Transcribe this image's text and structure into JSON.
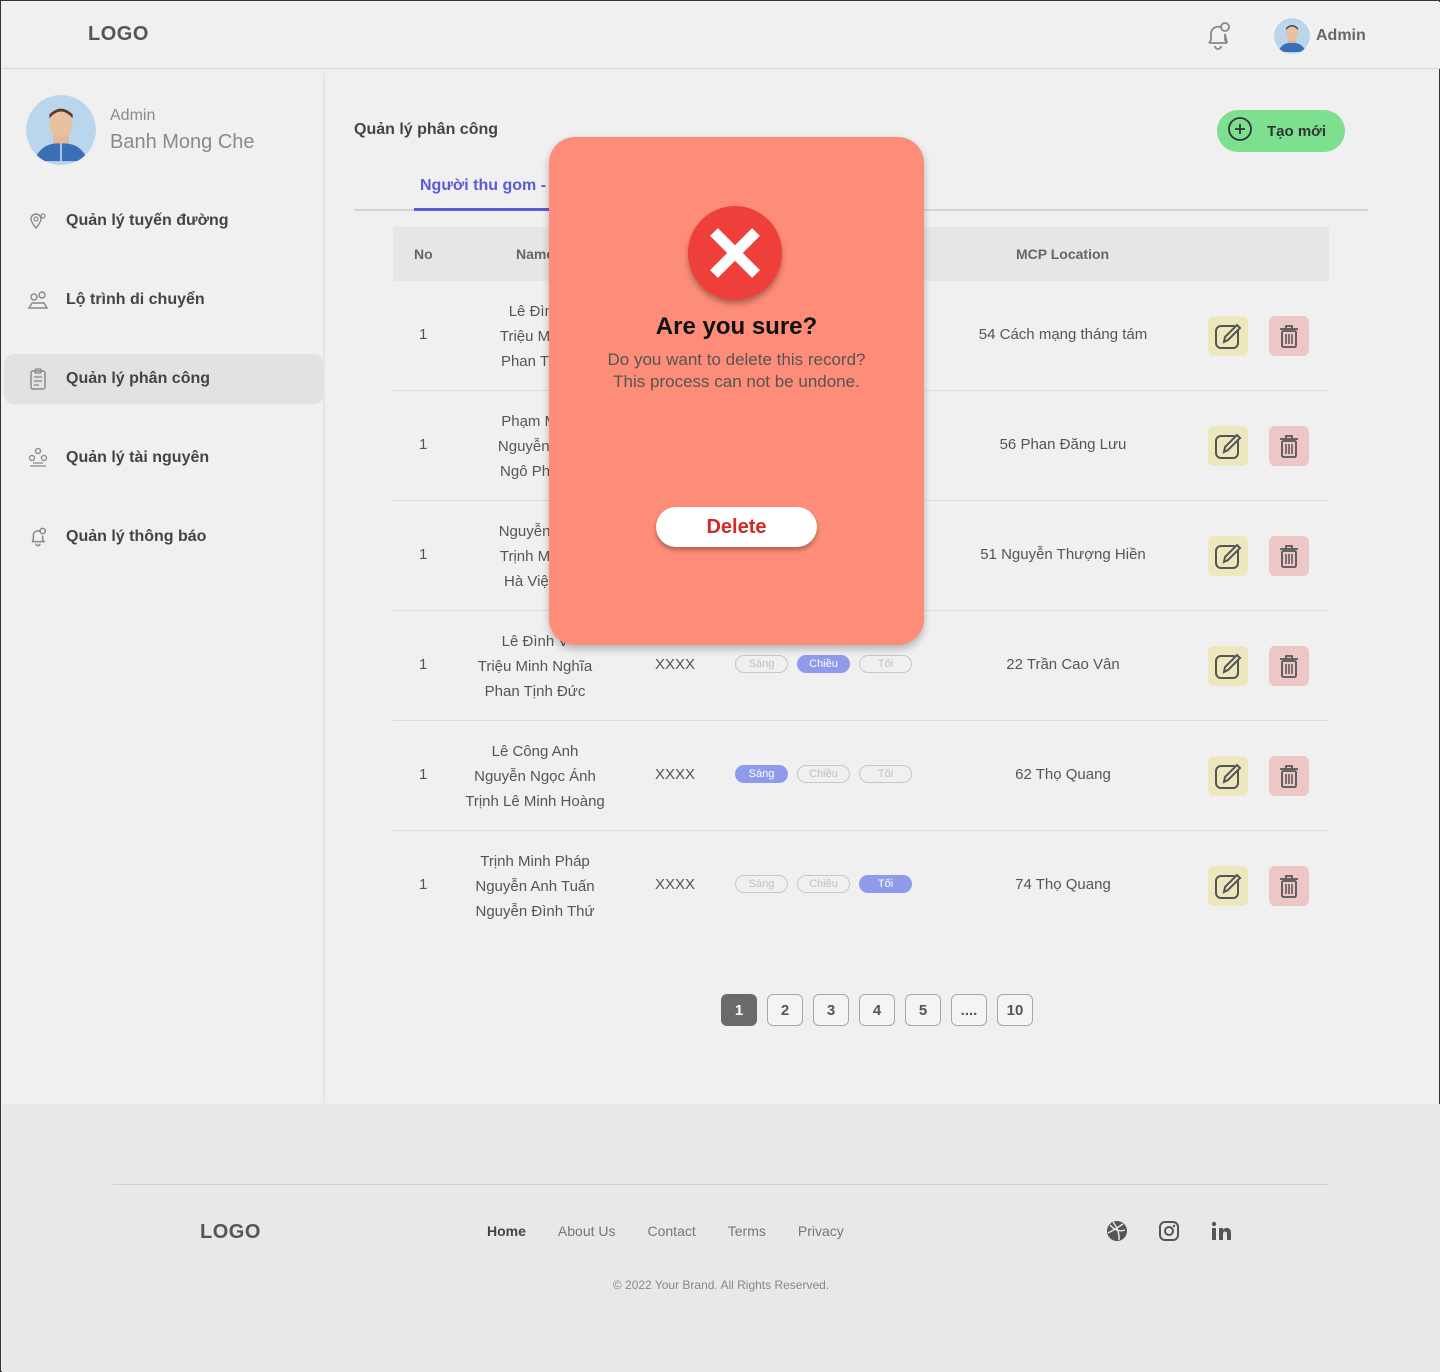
{
  "header": {
    "logo": "LOGO",
    "user_name": "Admin"
  },
  "sidebar": {
    "role": "Admin",
    "name": "Banh Mong Che",
    "items": [
      {
        "label": "Quản lý tuyến đường",
        "icon": "map-pin-icon"
      },
      {
        "label": "Lộ trình di chuyển",
        "icon": "route-icon"
      },
      {
        "label": "Quản lý phân công",
        "icon": "clipboard-icon",
        "active": true
      },
      {
        "label": "Quản lý tài nguyên",
        "icon": "resources-icon"
      },
      {
        "label": "Quản lý thông báo",
        "icon": "bell-icon"
      }
    ]
  },
  "main": {
    "title": "Quản lý phân công",
    "create_label": "Tạo mới",
    "tab_label": "Người thu gom -",
    "columns": {
      "no": "No",
      "name": "Name",
      "location": "MCP Location"
    },
    "rows": [
      {
        "no": "1",
        "names": [
          "Lê Đình",
          "Triệu Minh",
          "Phan Tịnh"
        ],
        "vehicle": "",
        "shifts": [
          false,
          false,
          false
        ],
        "location": "54 Cách mạng tháng tám"
      },
      {
        "no": "1",
        "names": [
          "Phạm Min",
          "Nguyễn Ph",
          "Ngô Phươ"
        ],
        "vehicle": "",
        "shifts": [
          false,
          false,
          false
        ],
        "location": "56 Phan Đăng Lưu"
      },
      {
        "no": "1",
        "names": [
          "Nguyễn Tu",
          "Trịnh Minh",
          "Hà Việt T"
        ],
        "vehicle": "",
        "shifts": [
          false,
          false,
          false
        ],
        "location": "51 Nguyễn Thượng Hiền"
      },
      {
        "no": "1",
        "names": [
          "Lê Đình V",
          "Triệu Minh Nghĩa",
          "Phan Tịnh Đức"
        ],
        "vehicle": "XXXX",
        "shifts": [
          false,
          true,
          false
        ],
        "location": "22 Trần Cao Vân"
      },
      {
        "no": "1",
        "names": [
          "Lê Công Anh",
          "Nguyễn Ngọc Ánh",
          "Trịnh Lê Minh Hoàng"
        ],
        "vehicle": "XXXX",
        "shifts": [
          true,
          false,
          false
        ],
        "location": "62 Thọ Quang"
      },
      {
        "no": "1",
        "names": [
          "Trịnh Minh Pháp",
          "Nguyễn Anh Tuấn",
          "Nguyễn Đình Thứ"
        ],
        "vehicle": "XXXX",
        "shifts": [
          false,
          false,
          true
        ],
        "location": "74 Thọ Quang"
      }
    ],
    "shift_labels": [
      "Sáng",
      "Chiều",
      "Tối"
    ],
    "pages": [
      "1",
      "2",
      "3",
      "4",
      "5",
      "....",
      "10"
    ]
  },
  "modal": {
    "title": "Are you sure?",
    "line1": "Do you want to delete this record?",
    "line2": "This process can not be undone.",
    "button": "Delete"
  },
  "footer": {
    "logo": "LOGO",
    "links": [
      "Home",
      "About Us",
      "Contact",
      "Terms",
      "Privacy"
    ],
    "copyright": "© 2022 Your Brand. All Rights Reserved."
  },
  "colors": {
    "accent": "#5a5bd8",
    "create": "#7ce08f",
    "modal": "#fd8d78",
    "danger": "#ef3f3a",
    "shift_on": "#8f9bea"
  }
}
